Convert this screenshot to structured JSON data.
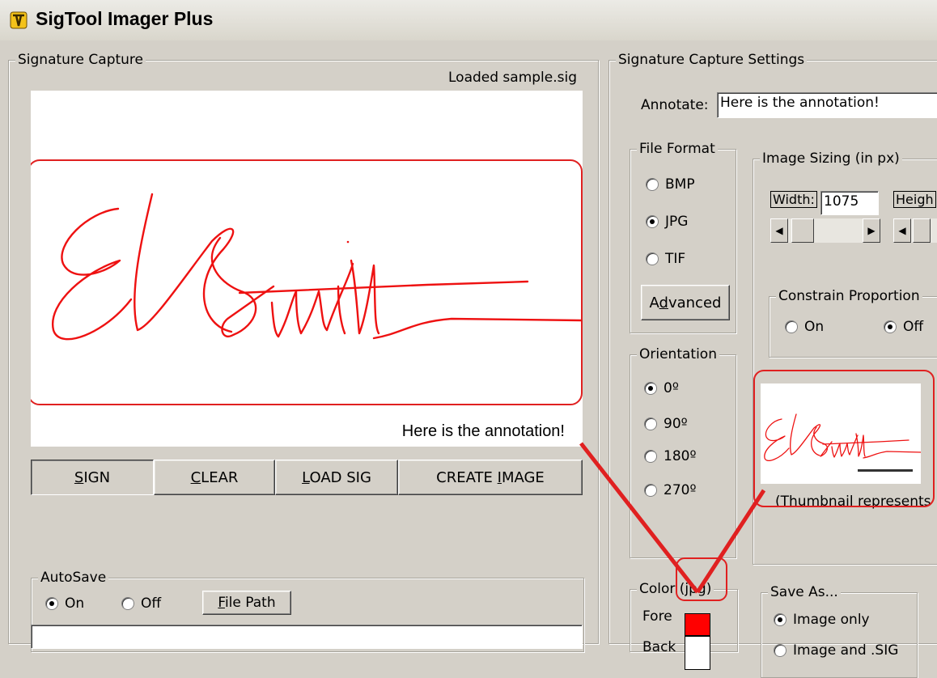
{
  "window": {
    "title": "SigTool Imager Plus"
  },
  "capture": {
    "legend": "Signature Capture",
    "status": "Loaded sample.sig",
    "annotation": "Here is the annotation!"
  },
  "buttons": {
    "sign": {
      "u": "S",
      "rest": "IGN"
    },
    "clear": {
      "u": "C",
      "rest": "LEAR"
    },
    "load": {
      "u": "L",
      "rest": "OAD SIG"
    },
    "create": {
      "pre": "CREATE ",
      "u": "I",
      "rest": "MAGE"
    }
  },
  "autosave": {
    "legend": "AutoSave",
    "on": "On",
    "off": "Off",
    "file_path": {
      "u": "F",
      "rest": "ile Path"
    },
    "selected": "On"
  },
  "settings": {
    "legend": "Signature Capture Settings",
    "annotate_label": "Annotate:",
    "annotate_value": "Here is the annotation!",
    "file_format": {
      "legend": "File Format",
      "options": [
        "BMP",
        "JPG",
        "TIF"
      ],
      "selected": "JPG",
      "advanced": {
        "pre": "A",
        "u": "d",
        "rest": "vanced"
      }
    },
    "orientation": {
      "legend": "Orientation",
      "options": [
        "0º",
        "90º",
        "180º",
        "270º"
      ],
      "selected": "0º"
    },
    "image_sizing": {
      "legend": "Image Sizing (in px)",
      "width_label": "Width:",
      "width_value": "1075",
      "height_label": "Heigh"
    },
    "constrain": {
      "legend": "Constrain Proportion",
      "on": "On",
      "off": "Off",
      "selected": "Off"
    },
    "thumbnail_caption": "(Thumbnail represents",
    "color": {
      "legend": "Color (jpg)",
      "fore_label": "Fore",
      "back_label": "Back",
      "fore": "#ff0000",
      "back": "#ffffff"
    },
    "save_as": {
      "legend": "Save As...",
      "options": [
        "Image only",
        "Image and .SIG"
      ],
      "selected": "Image only"
    }
  },
  "colors": {
    "accent": "#ff0000",
    "callout": "#e02020"
  }
}
